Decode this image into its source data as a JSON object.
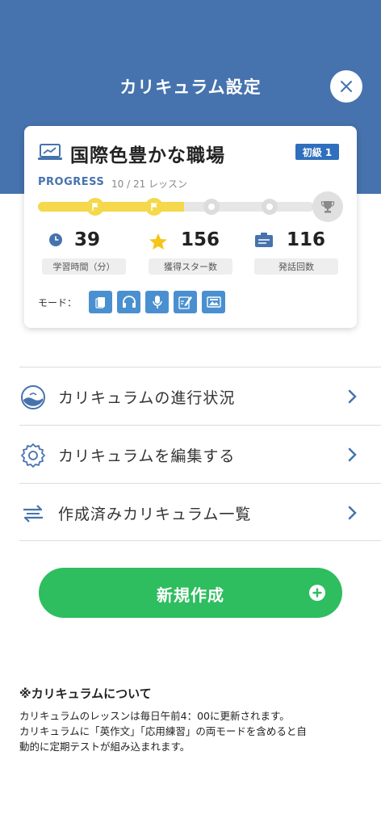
{
  "header": {
    "title": "カリキュラム設定",
    "background_color": "#4673ae",
    "close_icon": "close-icon"
  },
  "card": {
    "title": "国際色豊かな職場",
    "title_icon": "laptop-chart-icon",
    "level_badge": "初級 1",
    "progress_label": "PROGRESS",
    "progress_count": "10 / 21 レッスン",
    "progress_fraction": 0.48,
    "stats": [
      {
        "icon": "clock-icon",
        "value": "39",
        "label": "学習時間（分）"
      },
      {
        "icon": "star-icon",
        "value": "156",
        "label": "獲得スター数"
      },
      {
        "icon": "chat-card-icon",
        "value": "116",
        "label": "発話回数"
      }
    ],
    "mode_label": "モード：",
    "modes": [
      "flashcard-icon",
      "headphones-icon",
      "microphone-icon",
      "writing-icon",
      "image-card-icon"
    ]
  },
  "menu": {
    "items": [
      {
        "label": "カリキュラムの進行状況",
        "icon": "progress-globe-icon"
      },
      {
        "label": "カリキュラムを編集する",
        "icon": "gear-icon"
      },
      {
        "label": "作成済みカリキュラム一覧",
        "icon": "switch-arrows-icon"
      }
    ]
  },
  "new_button": {
    "label": "新規作成",
    "icon": "plus-circle-icon",
    "color": "#2ebd5f"
  },
  "note": {
    "title": "※カリキュラムについて",
    "line1": "カリキュラムのレッスンは毎日午前4：00に更新されます。",
    "line2": "カリキュラムに「英作文」「応用練習」の両モードを含めると自",
    "line3": "動的に定期テストが組み込まれます。"
  },
  "accent_colors": {
    "progress_yellow": "#f5d84b",
    "badge_blue": "#2f6fbd",
    "mode_blue": "#4a90d0"
  }
}
